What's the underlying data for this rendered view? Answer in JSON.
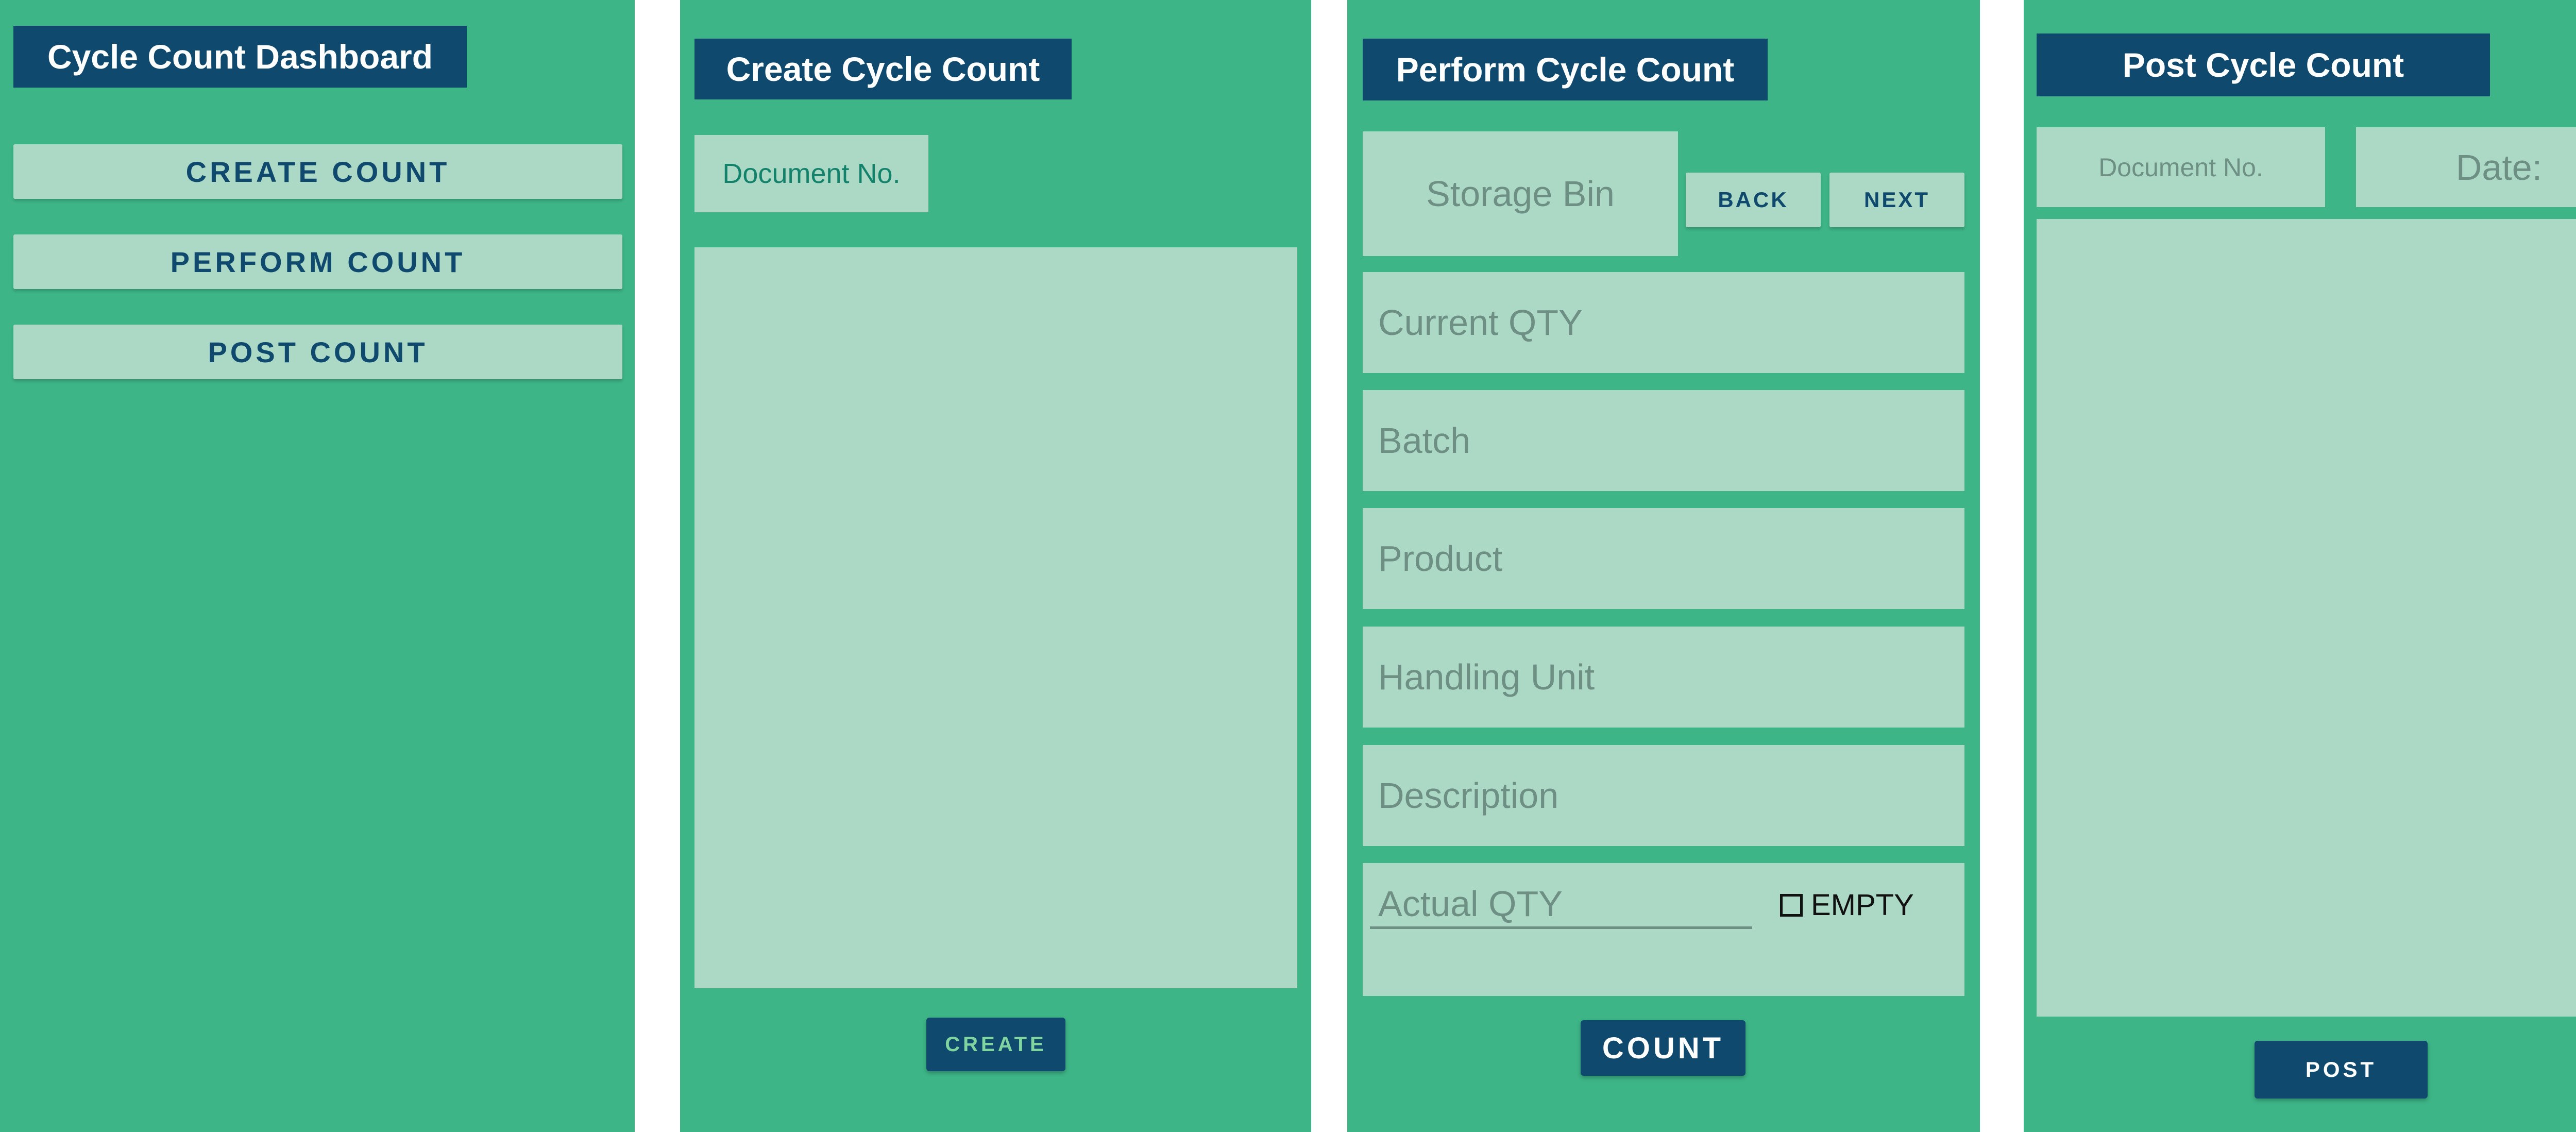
{
  "dashboard": {
    "title": "Cycle Count Dashboard",
    "buttons": [
      "CREATE COUNT",
      "PERFORM COUNT",
      "POST COUNT"
    ]
  },
  "create": {
    "title": "Create Cycle Count",
    "document_placeholder": "Document No.",
    "create_button": "CREATE"
  },
  "perform": {
    "title": "Perform Cycle Count",
    "storage_bin_placeholder": "Storage Bin",
    "back_button": "BACK",
    "next_button": "NEXT",
    "fields": [
      "Current QTY",
      "Batch",
      "Product",
      "Handling Unit",
      "Description"
    ],
    "actual_qty_placeholder": "Actual QTY",
    "empty_label": "EMPTY",
    "empty_checked": false,
    "count_button": "COUNT"
  },
  "post": {
    "title": "Post Cycle Count",
    "document_placeholder": "Document No.",
    "date_placeholder": "Date:",
    "post_button": "POST"
  },
  "colors": {
    "background": "#3db587",
    "header": "#0f4a6e",
    "field": "#acd9c6",
    "placeholder": "#6e8f84",
    "accent_text": "#13826a",
    "create_button_text": "#7fd4a0"
  }
}
